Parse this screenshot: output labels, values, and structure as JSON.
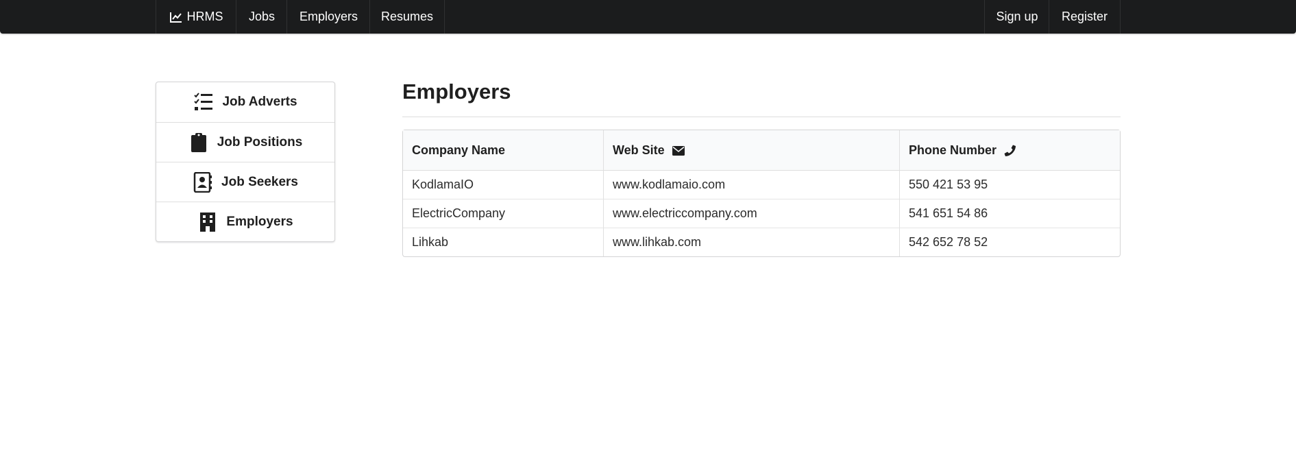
{
  "nav": {
    "brand": {
      "label": "HRMS",
      "icon": "chart-line-icon"
    },
    "left_items": [
      "Jobs",
      "Employers",
      "Resumes"
    ],
    "right_items": [
      "Sign up",
      "Register"
    ]
  },
  "sidebar": {
    "items": [
      {
        "label": "Job Adverts",
        "icon": "tasks-list-icon"
      },
      {
        "label": "Job Positions",
        "icon": "clipboard-icon"
      },
      {
        "label": "Job Seekers",
        "icon": "address-book-icon"
      },
      {
        "label": "Employers",
        "icon": "building-icon"
      }
    ]
  },
  "main": {
    "title": "Employers",
    "table": {
      "headers": [
        {
          "label": "Company Name",
          "icon": ""
        },
        {
          "label": "Web Site",
          "icon": "envelope-icon"
        },
        {
          "label": "Phone Number",
          "icon": "phone-icon"
        }
      ],
      "rows": [
        [
          "KodlamaIO",
          "www.kodlamaio.com",
          "550 421 53 95"
        ],
        [
          "ElectricCompany",
          "www.electriccompany.com",
          "541 651 54 86"
        ],
        [
          "Lihkab",
          "www.lihkab.com",
          "542 652 78 52"
        ]
      ]
    }
  },
  "colors": {
    "topbar": "#1b1c1d",
    "text": "#1f1f1f",
    "table_header_bg": "#f9fafb"
  }
}
